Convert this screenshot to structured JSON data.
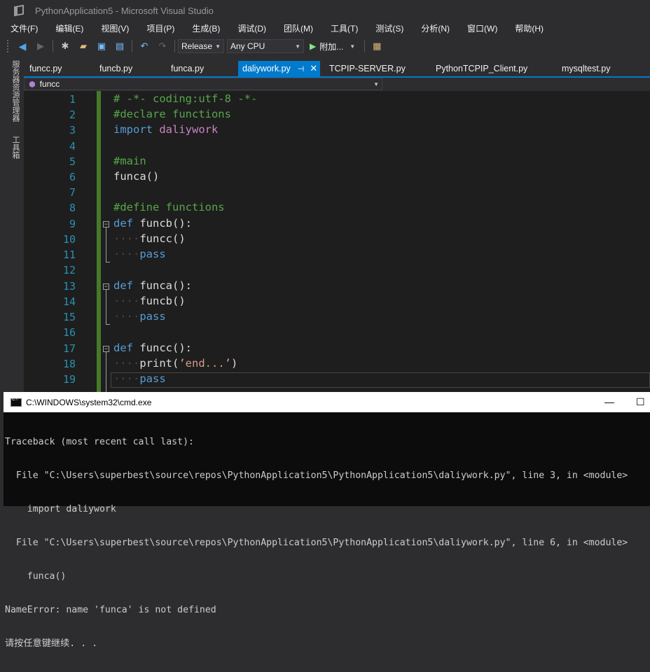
{
  "window": {
    "title": "PythonApplication5 - Microsoft Visual Studio"
  },
  "menu": [
    "文件(F)",
    "编辑(E)",
    "视图(V)",
    "项目(P)",
    "生成(B)",
    "调试(D)",
    "团队(M)",
    "工具(T)",
    "测试(S)",
    "分析(N)",
    "窗口(W)",
    "帮助(H)"
  ],
  "toolbar": {
    "config": "Release",
    "platform": "Any CPU",
    "attach_label": "附加..."
  },
  "side_tabs": {
    "server_explorer": "服务器资源管理器",
    "toolbox": "工具箱"
  },
  "tabs": [
    {
      "label": "funcc.py",
      "active": false
    },
    {
      "label": "funcb.py",
      "active": false
    },
    {
      "label": "funca.py",
      "active": false
    },
    {
      "label": "daliywork.py",
      "active": true
    },
    {
      "label": "TCPIP-SERVER.py",
      "active": false
    },
    {
      "label": "PythonTCPIP_Client.py",
      "active": false
    },
    {
      "label": "mysqltest.py",
      "active": false
    }
  ],
  "navbar": {
    "member": "funcc"
  },
  "editor": {
    "line_numbers": [
      "1",
      "2",
      "3",
      "4",
      "5",
      "6",
      "7",
      "8",
      "9",
      "10",
      "11",
      "12",
      "13",
      "14",
      "15",
      "16",
      "17",
      "18",
      "19"
    ],
    "lines": {
      "l1": "# -*- coding:utf-8 -*-",
      "l2": "#declare functions",
      "l3_kw": "import",
      "l3_mod": " daliywork",
      "l5": "#main",
      "l6": "funca()",
      "l8": "#define functions",
      "l9_kw": "def",
      "l9_rest": " funcb():",
      "l10": "funcc()",
      "l11": "pass",
      "l13_kw": "def",
      "l13_rest": " funca():",
      "l14": "funcb()",
      "l15": "pass",
      "l17_kw": "def",
      "l17_rest": " funcc():",
      "l18_fn": "print(",
      "l18_str": "’end...’",
      "l18_end": ")",
      "l19": "pass"
    }
  },
  "cmd": {
    "title": "C:\\WINDOWS\\system32\\cmd.exe",
    "output": [
      "Traceback (most recent call last):",
      "  File \"C:\\Users\\superbest\\source\\repos\\PythonApplication5\\PythonApplication5\\daliywork.py\", line 3, in <module>",
      "    import daliywork",
      "  File \"C:\\Users\\superbest\\source\\repos\\PythonApplication5\\PythonApplication5\\daliywork.py\", line 6, in <module>",
      "    funca()",
      "NameError: name 'funca' is not defined",
      "请按任意键继续. . ."
    ]
  }
}
